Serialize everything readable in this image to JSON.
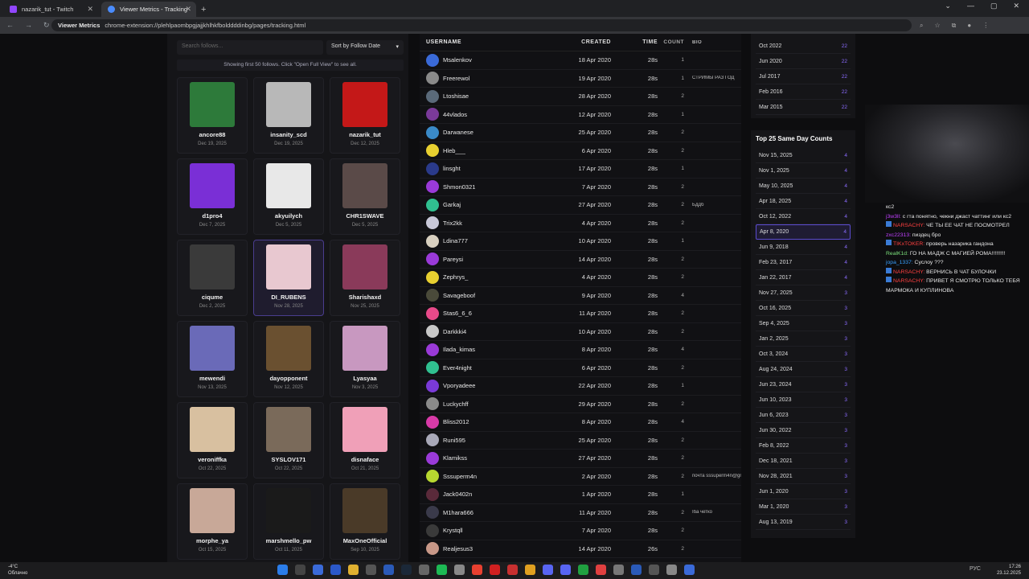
{
  "browser": {
    "tabs": [
      {
        "label": "nazarik_tut - Twitch"
      },
      {
        "label": "Viewer Metrics - Tracking"
      }
    ],
    "new_tab": "+",
    "ext_label": "Viewer Metrics",
    "url": "chrome-extension://plehlpaombpgjajjkhlhkfbolddddinbg/pages/tracking.html"
  },
  "follows": {
    "search_placeholder": "Search follows...",
    "sort_label": "Sort by Follow Date",
    "notice": "Showing first 50 follows. Click \"Open Full View\" to see all.",
    "cards": [
      {
        "name": "ancore88",
        "date": "Dec 19, 2025",
        "color": "#2d7a3a"
      },
      {
        "name": "insanity_scd",
        "date": "Dec 19, 2025",
        "color": "#b8b8b8"
      },
      {
        "name": "nazarik_tut",
        "date": "Dec 12, 2025",
        "color": "#c41818"
      },
      {
        "name": "d1pro4",
        "date": "Dec 7, 2025",
        "color": "#7a2fd6"
      },
      {
        "name": "akyuilych",
        "date": "Dec 5, 2025",
        "color": "#e8e8e8"
      },
      {
        "name": "CHR1SWAVE",
        "date": "Dec 5, 2025",
        "color": "#5a4a48"
      },
      {
        "name": "ciqume",
        "date": "Dec 2, 2025",
        "color": "#3a3a3a"
      },
      {
        "name": "DI_RUBENS",
        "date": "Nov 28, 2025",
        "color": "#e8c8d0"
      },
      {
        "name": "Sharishaxd",
        "date": "Nov 25, 2025",
        "color": "#8a3a5a"
      },
      {
        "name": "mewendi",
        "date": "Nov 13, 2025",
        "color": "#6a6ab8"
      },
      {
        "name": "dayopponent",
        "date": "Nov 12, 2025",
        "color": "#6a5030"
      },
      {
        "name": "Lyasyaa",
        "date": "Nov 3, 2025",
        "color": "#c898c0"
      },
      {
        "name": "veroniffka",
        "date": "Oct 22, 2025",
        "color": "#d8c0a0"
      },
      {
        "name": "SYSLOV171",
        "date": "Oct 22, 2025",
        "color": "#7a6a5a"
      },
      {
        "name": "disnaface",
        "date": "Oct 21, 2025",
        "color": "#f0a0b8"
      },
      {
        "name": "morphe_ya",
        "date": "Oct 15, 2025",
        "color": "#c8a898"
      },
      {
        "name": "marshmello_pw",
        "date": "Oct 11, 2025",
        "color": "#1a1a1a"
      },
      {
        "name": "MaxOneOfficial",
        "date": "Sep 10, 2025",
        "color": "#4a3a28"
      }
    ]
  },
  "table": {
    "headers": {
      "username": "USERNAME",
      "created": "CREATED",
      "time": "TIME",
      "count": "COUNT",
      "bio": "BIO"
    },
    "rows": [
      {
        "user": "Msalenkov",
        "created": "18 Apr 2020",
        "time": "28s",
        "count": "1",
        "bio": "",
        "color": "#3a6ad8"
      },
      {
        "user": "Freerewol",
        "created": "19 Apr 2020",
        "time": "28s",
        "count": "1",
        "bio": "СТРИМЫ РАЗ ГОД",
        "color": "#8a8a8a"
      },
      {
        "user": "Ltoshisae",
        "created": "28 Apr 2020",
        "time": "28s",
        "count": "2",
        "bio": "",
        "color": "#5a6a7a"
      },
      {
        "user": "44vlados",
        "created": "12 Apr 2020",
        "time": "28s",
        "count": "1",
        "bio": "",
        "color": "#7a3a9a"
      },
      {
        "user": "Darwanese",
        "created": "25 Apr 2020",
        "time": "28s",
        "count": "2",
        "bio": "",
        "color": "#3a8ac8"
      },
      {
        "user": "Hleb___",
        "created": "6 Apr 2020",
        "time": "28s",
        "count": "2",
        "bio": "",
        "color": "#e8d030"
      },
      {
        "user": "linsght",
        "created": "17 Apr 2020",
        "time": "28s",
        "count": "1",
        "bio": "",
        "color": "#2a3a8a"
      },
      {
        "user": "Shmon0321",
        "created": "7 Apr 2020",
        "time": "28s",
        "count": "2",
        "bio": "",
        "color": "#9a3ad8"
      },
      {
        "user": "Garkaj",
        "created": "27 Apr 2020",
        "time": "28s",
        "count": "2",
        "bio": "Бддб",
        "color": "#30c090"
      },
      {
        "user": "Trix2kk",
        "created": "4 Apr 2020",
        "time": "28s",
        "count": "2",
        "bio": "",
        "color": "#c8c8d8"
      },
      {
        "user": "Ldina777",
        "created": "10 Apr 2020",
        "time": "28s",
        "count": "1",
        "bio": "",
        "color": "#d8d0c0"
      },
      {
        "user": "Pareysi",
        "created": "14 Apr 2020",
        "time": "28s",
        "count": "2",
        "bio": "",
        "color": "#9a3ad8"
      },
      {
        "user": "Zephrys_",
        "created": "4 Apr 2020",
        "time": "28s",
        "count": "2",
        "bio": "",
        "color": "#e8d030"
      },
      {
        "user": "Savageboof",
        "created": "9 Apr 2020",
        "time": "28s",
        "count": "4",
        "bio": "",
        "color": "#4a4a3a"
      },
      {
        "user": "Stas6_6_6",
        "created": "11 Apr 2020",
        "time": "28s",
        "count": "2",
        "bio": "",
        "color": "#e84a8a"
      },
      {
        "user": "Darkkki4",
        "created": "10 Apr 2020",
        "time": "28s",
        "count": "2",
        "bio": "",
        "color": "#c8c8c8"
      },
      {
        "user": "Ilada_kimas",
        "created": "8 Apr 2020",
        "time": "28s",
        "count": "4",
        "bio": "",
        "color": "#9a3ad8"
      },
      {
        "user": "Ever4night",
        "created": "6 Apr 2020",
        "time": "28s",
        "count": "2",
        "bio": "",
        "color": "#30c090"
      },
      {
        "user": "Vporyadeee",
        "created": "22 Apr 2020",
        "time": "28s",
        "count": "1",
        "bio": "",
        "color": "#7a3ad8"
      },
      {
        "user": "Luckychff",
        "created": "29 Apr 2020",
        "time": "28s",
        "count": "2",
        "bio": "",
        "color": "#8a8a8a"
      },
      {
        "user": "Bliss2012",
        "created": "8 Apr 2020",
        "time": "28s",
        "count": "4",
        "bio": "",
        "color": "#d83aa8"
      },
      {
        "user": "Runi595",
        "created": "25 Apr 2020",
        "time": "28s",
        "count": "2",
        "bio": "",
        "color": "#a8a8b8"
      },
      {
        "user": "Klamikss",
        "created": "27 Apr 2020",
        "time": "28s",
        "count": "2",
        "bio": "",
        "color": "#9a3ad8"
      },
      {
        "user": "Sssuperm4n",
        "created": "2 Apr 2020",
        "time": "28s",
        "count": "2",
        "bio": "почта sssuperm4n@gmail...",
        "color": "#b8d830"
      },
      {
        "user": "Jack0402n",
        "created": "1 Apr 2020",
        "time": "28s",
        "count": "1",
        "bio": "",
        "color": "#5a2a3a"
      },
      {
        "user": "M1hara666",
        "created": "11 Apr 2020",
        "time": "28s",
        "count": "2",
        "bio": "Iба четко",
        "color": "#3a3a4a"
      },
      {
        "user": "Krystqll",
        "created": "7 Apr 2020",
        "time": "28s",
        "count": "2",
        "bio": "",
        "color": "#3a3a3a"
      },
      {
        "user": "Realjesus3",
        "created": "14 Apr 2020",
        "time": "26s",
        "count": "2",
        "bio": "",
        "color": "#c89888"
      }
    ]
  },
  "top_months": [
    {
      "date": "Oct 2022",
      "count": "22"
    },
    {
      "date": "Jun 2020",
      "count": "22"
    },
    {
      "date": "Jul 2017",
      "count": "22"
    },
    {
      "date": "Feb 2016",
      "count": "22"
    },
    {
      "date": "Mar 2015",
      "count": "22"
    }
  ],
  "top25": {
    "title": "Top 25 Same Day Counts",
    "rows": [
      {
        "date": "Nov 15, 2025",
        "count": "4"
      },
      {
        "date": "Nov 1, 2025",
        "count": "4"
      },
      {
        "date": "May 10, 2025",
        "count": "4"
      },
      {
        "date": "Apr 18, 2025",
        "count": "4"
      },
      {
        "date": "Oct 12, 2022",
        "count": "4"
      },
      {
        "date": "Apr 8, 2020",
        "count": "4"
      },
      {
        "date": "Jun 9, 2018",
        "count": "4"
      },
      {
        "date": "Feb 23, 2017",
        "count": "4"
      },
      {
        "date": "Jan 22, 2017",
        "count": "4"
      },
      {
        "date": "Nov 27, 2025",
        "count": "3"
      },
      {
        "date": "Oct 16, 2025",
        "count": "3"
      },
      {
        "date": "Sep 4, 2025",
        "count": "3"
      },
      {
        "date": "Jan 2, 2025",
        "count": "3"
      },
      {
        "date": "Oct 3, 2024",
        "count": "3"
      },
      {
        "date": "Aug 24, 2024",
        "count": "3"
      },
      {
        "date": "Jun 23, 2024",
        "count": "3"
      },
      {
        "date": "Jun 10, 2023",
        "count": "3"
      },
      {
        "date": "Jun 6, 2023",
        "count": "3"
      },
      {
        "date": "Jun 30, 2022",
        "count": "3"
      },
      {
        "date": "Feb 8, 2022",
        "count": "3"
      },
      {
        "date": "Dec 18, 2021",
        "count": "3"
      },
      {
        "date": "Nov 28, 2021",
        "count": "3"
      },
      {
        "date": "Jun 1, 2020",
        "count": "3"
      },
      {
        "date": "Mar 1, 2020",
        "count": "3"
      },
      {
        "date": "Aug 13, 2019",
        "count": "3"
      }
    ],
    "highlight_index": 5
  },
  "chat": [
    {
      "user": "",
      "text": "кс2"
    },
    {
      "user": "j3w3ll:",
      "text": "с гта понятно, чекни джаст чаттинг или кс2"
    },
    {
      "user": "NARSACHY:",
      "text": "ЧЕ ТЫ ЕЕ ЧАТ НЕ ПОСМОТРЕЛ"
    },
    {
      "user": "zxc22313:",
      "text": "пиздец бро"
    },
    {
      "user": "TIKxTOKER:",
      "text": "проверь назарика гандона"
    },
    {
      "user": "RealK1d:",
      "text": "ГО НА МАДЖ С МАГИЕЙ РОМА!!!!!!!!!"
    },
    {
      "user": "jopa_1337:",
      "text": "Суслоу ???"
    },
    {
      "user": "NARSACHY:",
      "text": "ВЕРНИСЬ В ЧАТ БУЛОЧКИ"
    },
    {
      "user": "NARSACHY:",
      "text": "ПРИВЕТ Я СМОТРЮ ТОЛЬКО ТЕБЯ МАРМОКА И КУПЛИНОВА"
    }
  ],
  "taskbar": {
    "weather_temp": "-4°C",
    "weather_desc": "Облачно",
    "lang": "РУС",
    "time": "17:26",
    "date": "23.12.2025"
  }
}
